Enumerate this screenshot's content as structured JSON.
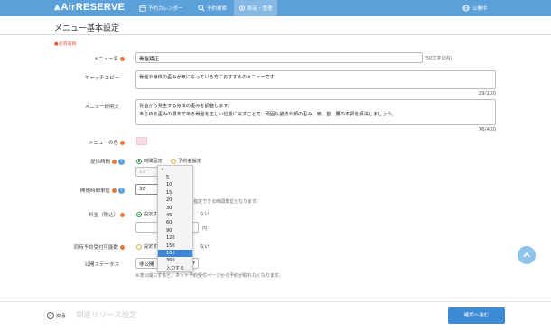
{
  "header": {
    "logo": "AirRESERVE",
    "nav": [
      {
        "label": "予約カレンダー"
      },
      {
        "label": "予約検索"
      },
      {
        "label": "設定・管理"
      }
    ],
    "right_label": "公開中"
  },
  "page": {
    "title": "メニュー基本設定",
    "required_note": "●必須項目"
  },
  "form": {
    "menu_name": {
      "label": "メニュー名",
      "value": "骨盤矯正",
      "hint": "(50文字以内)"
    },
    "catch_copy": {
      "label": "キャッチコピー",
      "value": "骨盤や身体の歪みが気になっている方におすすめのメニューです",
      "counter": "29/100"
    },
    "description": {
      "label": "メニュー説明文",
      "line1": "骨盤から発生する身体の歪みを調整します。",
      "line2": "あらゆる歪みの根本である骨盤を正しい位置に戻すことで、頑固な姿勢や顔の歪み、肩、首、腰の不調を解決しましょう。",
      "counter": "76/400"
    },
    "color": {
      "label": "メニューの色"
    },
    "duration": {
      "label": "提供時間",
      "option_fixed": "時間固定",
      "option_customer": "予約者設定",
      "value": "10"
    },
    "interval": {
      "label": "開始時間単位",
      "value": "30",
      "hint": "※お客様が予約の開始時間を指定できる時間単位となります。"
    },
    "price": {
      "label": "料金（税込）",
      "option_set": "設定する",
      "option_none_suffix": "ない",
      "unit": "円"
    },
    "concurrent": {
      "label": "同時予約受付可能数",
      "option_set": "設定する",
      "option_none_suffix": "ない"
    },
    "status": {
      "label": "公開ステータス",
      "value": "非公開",
      "hint": "※非公開にすると、ネット予約受付ページから予約が取れなくなります。"
    }
  },
  "dropdown": {
    "options": [
      "5",
      "10",
      "15",
      "20",
      "30",
      "45",
      "60",
      "90",
      "120",
      "150",
      "180",
      "360",
      "入力する"
    ],
    "selected": "180"
  },
  "footer": {
    "back_label": "戻る",
    "ghost_section": "関連リソース設定",
    "next_label": "確認へ進む"
  }
}
